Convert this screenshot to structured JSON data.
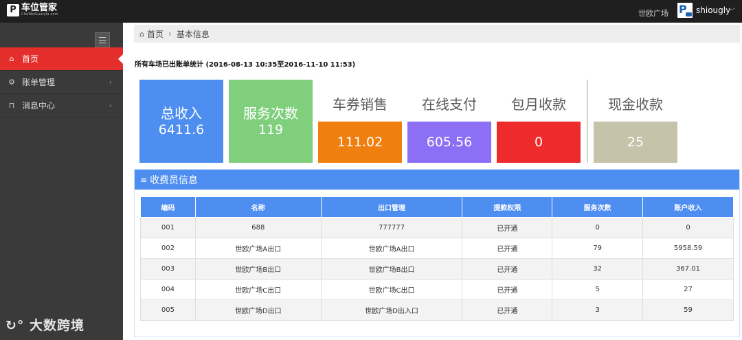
{
  "header": {
    "logo_mark": "P",
    "logo_title": "车位管家",
    "logo_subtitle": "CheWeiGuanJia.com",
    "location": "世欧广场",
    "user_name": "shiougly",
    "user_caret": "﹀"
  },
  "sidebar": {
    "items": [
      {
        "label": "首页",
        "icon": "home-icon",
        "glyph": "⌂",
        "active": true
      },
      {
        "label": "账单管理",
        "icon": "gears-icon",
        "glyph": "⚙",
        "arrow": "‹"
      },
      {
        "label": "消息中心",
        "icon": "bookmark-icon",
        "glyph": "⊓",
        "arrow": "‹"
      }
    ],
    "watermark": "大数跨境"
  },
  "breadcrumb": {
    "home_glyph": "⌂",
    "home": "首页",
    "sep": "›",
    "current": "基本信息"
  },
  "stats": {
    "title": "所有车场已出账单统计 (2016-08-13 10:35至2016-11-10 11:53)",
    "total": {
      "label": "总收入",
      "value": "6411.6",
      "color": "#4d8ef0"
    },
    "service": {
      "label": "服务次数",
      "value": "119",
      "color": "#7fcf7c"
    },
    "cards": [
      {
        "label": "车券销售",
        "value": "111.02",
        "color": "#ef7f0f"
      },
      {
        "label": "在线支付",
        "value": "605.56",
        "color": "#8d6ff5"
      },
      {
        "label": "包月收款",
        "value": "0",
        "color": "#ee2a2c"
      },
      {
        "label": "现金收款",
        "value": "25",
        "color": "#c6c3ab"
      }
    ]
  },
  "panel": {
    "title_glyph": "≡",
    "title": "收费员信息",
    "columns": [
      "编码",
      "名称",
      "出口管理",
      "提款权限",
      "服务次数",
      "账户收入"
    ],
    "rows": [
      [
        "001",
        "688",
        "777777",
        "已开通",
        "0",
        "0"
      ],
      [
        "002",
        "世欧广场A出口",
        "世欧广场A出口",
        "已开通",
        "79",
        "5958.59"
      ],
      [
        "003",
        "世欧广场B出口",
        "世欧广场B出口",
        "已开通",
        "32",
        "367.01"
      ],
      [
        "004",
        "世欧广场C出口",
        "世欧广场C出口",
        "已开通",
        "5",
        "27"
      ],
      [
        "005",
        "世欧广场D出口",
        "世欧广场D出入口",
        "已开通",
        "3",
        "59"
      ]
    ]
  }
}
